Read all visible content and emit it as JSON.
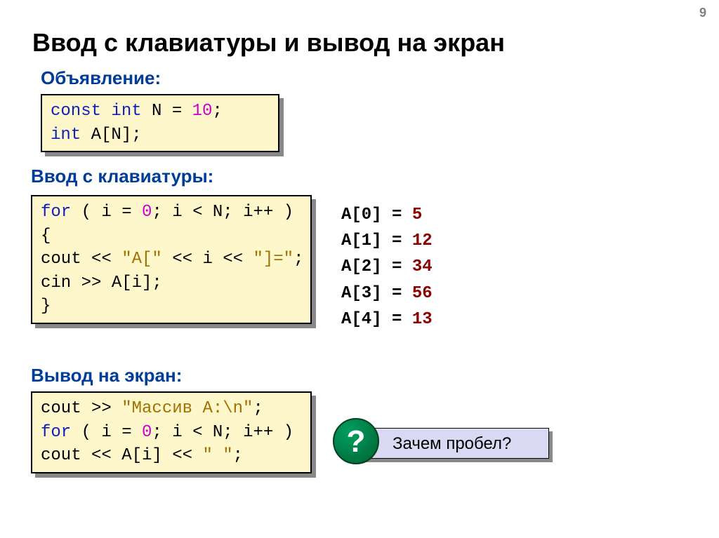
{
  "page_number": "9",
  "title": "Ввод с клавиатуры и вывод на экран",
  "subheads": {
    "declare": "Объявление:",
    "input": "Ввод с клавиатуры:",
    "output": "Вывод на экран:"
  },
  "code_declare": {
    "kw_const": "const",
    "kw_int1": "int",
    "txt_N_eq": " N = ",
    "num_10": "10",
    "semi1": ";",
    "kw_int2": "int",
    "txt_AN": " A[N];"
  },
  "code_input": {
    "kw_for": "for",
    "txt_open": " ( i = ",
    "num_0": "0",
    "txt_cond": "; i < N; i++ )",
    "txt_brace_open": "  {",
    "txt_cout": "  cout << ",
    "str_Aopen": "\"A[\"",
    "txt_mid": " << i << ",
    "str_close": "\"]=\"",
    "semi2": ";",
    "txt_cin": "  cin >> A[i];",
    "txt_brace_close": "  }"
  },
  "code_output": {
    "txt_cout1": "cout >> ",
    "str_mass": "\"Массив A:\\n\"",
    "semi3": ";",
    "kw_for": "for",
    "txt_open": " ( i = ",
    "num_0": "0",
    "txt_cond": "; i < N; i++ )",
    "txt_cout2": "  cout << A[i] << ",
    "str_space": "\" \"",
    "semi4": ";"
  },
  "sample_rows": [
    {
      "idx": "A[0] =",
      "val": " 5"
    },
    {
      "idx": "A[1] =",
      "val": " 12"
    },
    {
      "idx": "A[2] =",
      "val": " 34"
    },
    {
      "idx": "A[3] =",
      "val": " 56"
    },
    {
      "idx": "A[4] =",
      "val": " 13"
    }
  ],
  "callout": {
    "badge": "?",
    "text": "Зачем пробел?"
  }
}
